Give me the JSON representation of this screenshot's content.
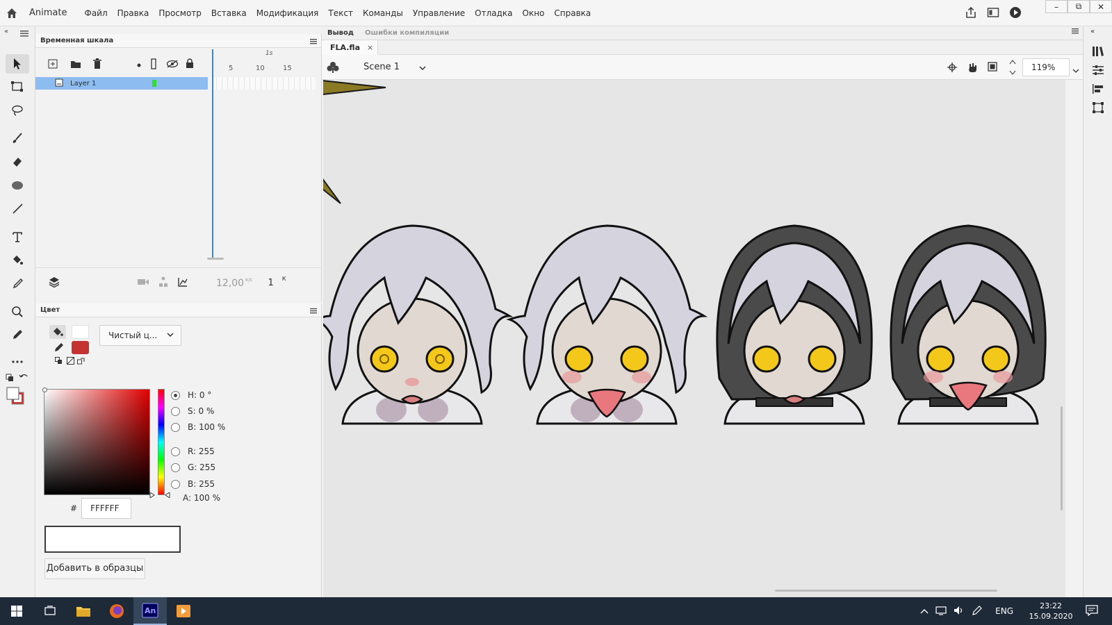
{
  "app": {
    "name": "Animate",
    "menu": [
      "Файл",
      "Правка",
      "Просмотр",
      "Вставка",
      "Модификация",
      "Текст",
      "Команды",
      "Управление",
      "Отладка",
      "Окно",
      "Справка"
    ],
    "window_controls": [
      "–",
      "⧉",
      "✕"
    ]
  },
  "timeline": {
    "tab_title": "Временная шкала",
    "layer_name": "Layer 1",
    "ruler_seconds": "1s",
    "ruler_ticks": [
      "5",
      "10",
      "15"
    ],
    "fps": "12,00",
    "fps_unit": "к/с",
    "current_frame": "1",
    "frame_unit": "К"
  },
  "color_panel": {
    "tab_title": "Цвет",
    "fill_type": "Чистый ц...",
    "stroke_color": "#c53232",
    "fill_color": "#ffffff",
    "params": [
      {
        "label": "H:",
        "value": "0 °",
        "checked": true
      },
      {
        "label": "S:",
        "value": "0 %",
        "checked": false
      },
      {
        "label": "B:",
        "value": "100 %",
        "checked": false
      },
      {
        "label": "R:",
        "value": "255",
        "checked": false
      },
      {
        "label": "G:",
        "value": "255",
        "checked": false
      },
      {
        "label": "B:",
        "value": "255",
        "checked": false
      }
    ],
    "alpha_label": "A:",
    "alpha_value": "100 %",
    "hex_prefix": "#",
    "hex_value": "FFFFFF",
    "add_button": "Добавить в образцы"
  },
  "stage": {
    "output_tab": "Вывод",
    "errors_tab": "Ошибки компиляции",
    "doc_tab": "FLA.fla",
    "doc_close": "×",
    "scene": "Scene 1",
    "zoom": "119%"
  },
  "taskbar": {
    "lang": "ENG",
    "time": "23:22",
    "date": "15.09.2020"
  }
}
